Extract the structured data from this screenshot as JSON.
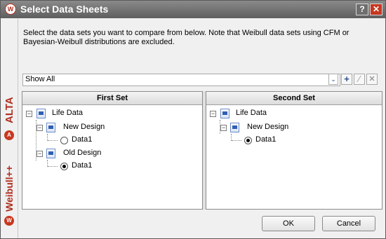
{
  "window": {
    "title": "Select Data Sheets",
    "logo": "W",
    "help_label": "?",
    "close_label": "✕"
  },
  "sidebar": {
    "product_top": "ALTA",
    "product_bottom": "Weibull++",
    "badge_top": "A",
    "badge_bottom": "W"
  },
  "instructions": "Select the data sets you want to compare from below. Note that Weibull data sets using CFM or Bayesian-Weibull distributions are excluded.",
  "filter": {
    "value": "Show All",
    "arrow": "⌄",
    "add": "+",
    "edit": "∕",
    "delete": "✕"
  },
  "first_set": {
    "header": "First Set",
    "root": "Life Data",
    "folders": [
      {
        "name": "New Design",
        "item": "Data1",
        "selected": false
      },
      {
        "name": "Old Design",
        "item": "Data1",
        "selected": true
      }
    ]
  },
  "second_set": {
    "header": "Second Set",
    "root": "Life Data",
    "folders": [
      {
        "name": "New Design",
        "item": "Data1",
        "selected": true
      }
    ]
  },
  "buttons": {
    "ok": "OK",
    "cancel": "Cancel"
  }
}
